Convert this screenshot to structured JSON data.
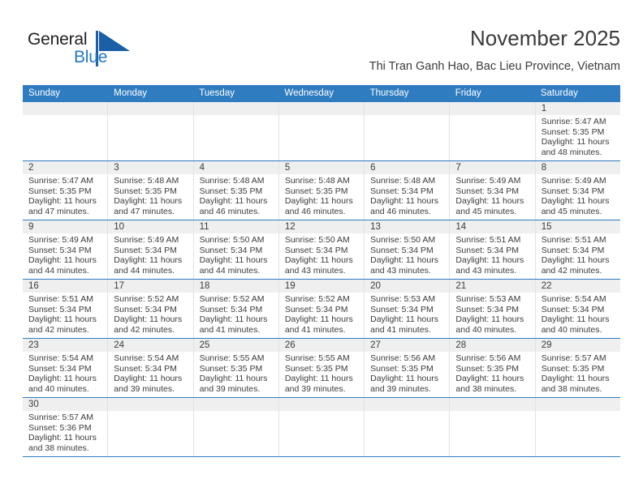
{
  "brand": {
    "name_part1": "General",
    "name_part2": "Blue",
    "accent_color": "#2277c8",
    "logo_icon": "blue-triangle-flag-icon"
  },
  "header": {
    "title": "November 2025",
    "subtitle": "Thi Tran Ganh Hao, Bac Lieu Province, Vietnam",
    "header_bg_color": "#2f7cc0"
  },
  "calendar": {
    "weekday_headers": [
      "Sunday",
      "Monday",
      "Tuesday",
      "Wednesday",
      "Thursday",
      "Friday",
      "Saturday"
    ],
    "weeks": [
      [
        {
          "day": "",
          "empty": true
        },
        {
          "day": "",
          "empty": true
        },
        {
          "day": "",
          "empty": true
        },
        {
          "day": "",
          "empty": true
        },
        {
          "day": "",
          "empty": true
        },
        {
          "day": "",
          "empty": true
        },
        {
          "day": "1",
          "sunrise": "Sunrise: 5:47 AM",
          "sunset": "Sunset: 5:35 PM",
          "daylight1": "Daylight: 11 hours",
          "daylight2": "and 48 minutes."
        }
      ],
      [
        {
          "day": "2",
          "sunrise": "Sunrise: 5:47 AM",
          "sunset": "Sunset: 5:35 PM",
          "daylight1": "Daylight: 11 hours",
          "daylight2": "and 47 minutes."
        },
        {
          "day": "3",
          "sunrise": "Sunrise: 5:48 AM",
          "sunset": "Sunset: 5:35 PM",
          "daylight1": "Daylight: 11 hours",
          "daylight2": "and 47 minutes."
        },
        {
          "day": "4",
          "sunrise": "Sunrise: 5:48 AM",
          "sunset": "Sunset: 5:35 PM",
          "daylight1": "Daylight: 11 hours",
          "daylight2": "and 46 minutes."
        },
        {
          "day": "5",
          "sunrise": "Sunrise: 5:48 AM",
          "sunset": "Sunset: 5:35 PM",
          "daylight1": "Daylight: 11 hours",
          "daylight2": "and 46 minutes."
        },
        {
          "day": "6",
          "sunrise": "Sunrise: 5:48 AM",
          "sunset": "Sunset: 5:34 PM",
          "daylight1": "Daylight: 11 hours",
          "daylight2": "and 46 minutes."
        },
        {
          "day": "7",
          "sunrise": "Sunrise: 5:49 AM",
          "sunset": "Sunset: 5:34 PM",
          "daylight1": "Daylight: 11 hours",
          "daylight2": "and 45 minutes."
        },
        {
          "day": "8",
          "sunrise": "Sunrise: 5:49 AM",
          "sunset": "Sunset: 5:34 PM",
          "daylight1": "Daylight: 11 hours",
          "daylight2": "and 45 minutes."
        }
      ],
      [
        {
          "day": "9",
          "sunrise": "Sunrise: 5:49 AM",
          "sunset": "Sunset: 5:34 PM",
          "daylight1": "Daylight: 11 hours",
          "daylight2": "and 44 minutes."
        },
        {
          "day": "10",
          "sunrise": "Sunrise: 5:49 AM",
          "sunset": "Sunset: 5:34 PM",
          "daylight1": "Daylight: 11 hours",
          "daylight2": "and 44 minutes."
        },
        {
          "day": "11",
          "sunrise": "Sunrise: 5:50 AM",
          "sunset": "Sunset: 5:34 PM",
          "daylight1": "Daylight: 11 hours",
          "daylight2": "and 44 minutes."
        },
        {
          "day": "12",
          "sunrise": "Sunrise: 5:50 AM",
          "sunset": "Sunset: 5:34 PM",
          "daylight1": "Daylight: 11 hours",
          "daylight2": "and 43 minutes."
        },
        {
          "day": "13",
          "sunrise": "Sunrise: 5:50 AM",
          "sunset": "Sunset: 5:34 PM",
          "daylight1": "Daylight: 11 hours",
          "daylight2": "and 43 minutes."
        },
        {
          "day": "14",
          "sunrise": "Sunrise: 5:51 AM",
          "sunset": "Sunset: 5:34 PM",
          "daylight1": "Daylight: 11 hours",
          "daylight2": "and 43 minutes."
        },
        {
          "day": "15",
          "sunrise": "Sunrise: 5:51 AM",
          "sunset": "Sunset: 5:34 PM",
          "daylight1": "Daylight: 11 hours",
          "daylight2": "and 42 minutes."
        }
      ],
      [
        {
          "day": "16",
          "sunrise": "Sunrise: 5:51 AM",
          "sunset": "Sunset: 5:34 PM",
          "daylight1": "Daylight: 11 hours",
          "daylight2": "and 42 minutes."
        },
        {
          "day": "17",
          "sunrise": "Sunrise: 5:52 AM",
          "sunset": "Sunset: 5:34 PM",
          "daylight1": "Daylight: 11 hours",
          "daylight2": "and 42 minutes."
        },
        {
          "day": "18",
          "sunrise": "Sunrise: 5:52 AM",
          "sunset": "Sunset: 5:34 PM",
          "daylight1": "Daylight: 11 hours",
          "daylight2": "and 41 minutes."
        },
        {
          "day": "19",
          "sunrise": "Sunrise: 5:52 AM",
          "sunset": "Sunset: 5:34 PM",
          "daylight1": "Daylight: 11 hours",
          "daylight2": "and 41 minutes."
        },
        {
          "day": "20",
          "sunrise": "Sunrise: 5:53 AM",
          "sunset": "Sunset: 5:34 PM",
          "daylight1": "Daylight: 11 hours",
          "daylight2": "and 41 minutes."
        },
        {
          "day": "21",
          "sunrise": "Sunrise: 5:53 AM",
          "sunset": "Sunset: 5:34 PM",
          "daylight1": "Daylight: 11 hours",
          "daylight2": "and 40 minutes."
        },
        {
          "day": "22",
          "sunrise": "Sunrise: 5:54 AM",
          "sunset": "Sunset: 5:34 PM",
          "daylight1": "Daylight: 11 hours",
          "daylight2": "and 40 minutes."
        }
      ],
      [
        {
          "day": "23",
          "sunrise": "Sunrise: 5:54 AM",
          "sunset": "Sunset: 5:34 PM",
          "daylight1": "Daylight: 11 hours",
          "daylight2": "and 40 minutes."
        },
        {
          "day": "24",
          "sunrise": "Sunrise: 5:54 AM",
          "sunset": "Sunset: 5:34 PM",
          "daylight1": "Daylight: 11 hours",
          "daylight2": "and 39 minutes."
        },
        {
          "day": "25",
          "sunrise": "Sunrise: 5:55 AM",
          "sunset": "Sunset: 5:35 PM",
          "daylight1": "Daylight: 11 hours",
          "daylight2": "and 39 minutes."
        },
        {
          "day": "26",
          "sunrise": "Sunrise: 5:55 AM",
          "sunset": "Sunset: 5:35 PM",
          "daylight1": "Daylight: 11 hours",
          "daylight2": "and 39 minutes."
        },
        {
          "day": "27",
          "sunrise": "Sunrise: 5:56 AM",
          "sunset": "Sunset: 5:35 PM",
          "daylight1": "Daylight: 11 hours",
          "daylight2": "and 39 minutes."
        },
        {
          "day": "28",
          "sunrise": "Sunrise: 5:56 AM",
          "sunset": "Sunset: 5:35 PM",
          "daylight1": "Daylight: 11 hours",
          "daylight2": "and 38 minutes."
        },
        {
          "day": "29",
          "sunrise": "Sunrise: 5:57 AM",
          "sunset": "Sunset: 5:35 PM",
          "daylight1": "Daylight: 11 hours",
          "daylight2": "and 38 minutes."
        }
      ],
      [
        {
          "day": "30",
          "sunrise": "Sunrise: 5:57 AM",
          "sunset": "Sunset: 5:36 PM",
          "daylight1": "Daylight: 11 hours",
          "daylight2": "and 38 minutes."
        },
        {
          "day": "",
          "empty": true
        },
        {
          "day": "",
          "empty": true
        },
        {
          "day": "",
          "empty": true
        },
        {
          "day": "",
          "empty": true
        },
        {
          "day": "",
          "empty": true
        },
        {
          "day": "",
          "empty": true
        }
      ]
    ]
  }
}
